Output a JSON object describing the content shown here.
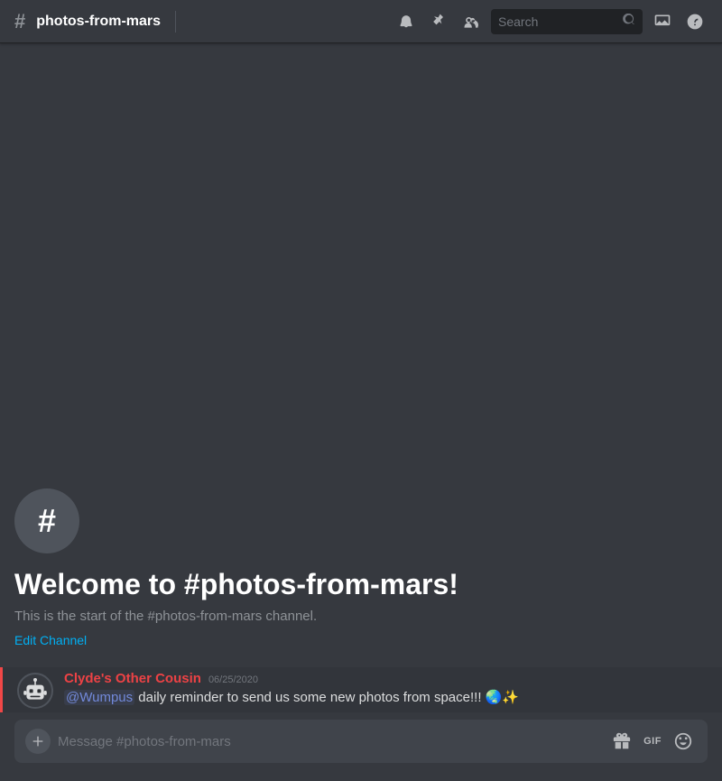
{
  "header": {
    "channel_icon": "#",
    "channel_name": "photos-from-mars",
    "search_placeholder": "Search"
  },
  "welcome": {
    "icon_symbol": "#",
    "title": "Welcome to #photos-from-mars!",
    "subtitle": "This is the start of the #photos-from-mars channel.",
    "edit_channel_label": "Edit Channel"
  },
  "messages": [
    {
      "author": "Clyde's Other Cousin",
      "timestamp": "06/25/2020",
      "mention": "@Wumpus",
      "text_after": " daily reminder to send us some new photos from space!!! 🌏✨"
    }
  ],
  "input": {
    "placeholder": "Message #photos-from-mars",
    "add_icon": "+",
    "gift_label": "🎁",
    "gif_label": "GIF",
    "emoji_label": "😊"
  },
  "icons": {
    "bell": "🔔",
    "pin": "📌",
    "members": "👤",
    "search": "🔍",
    "inbox": "📥",
    "help": "?"
  }
}
